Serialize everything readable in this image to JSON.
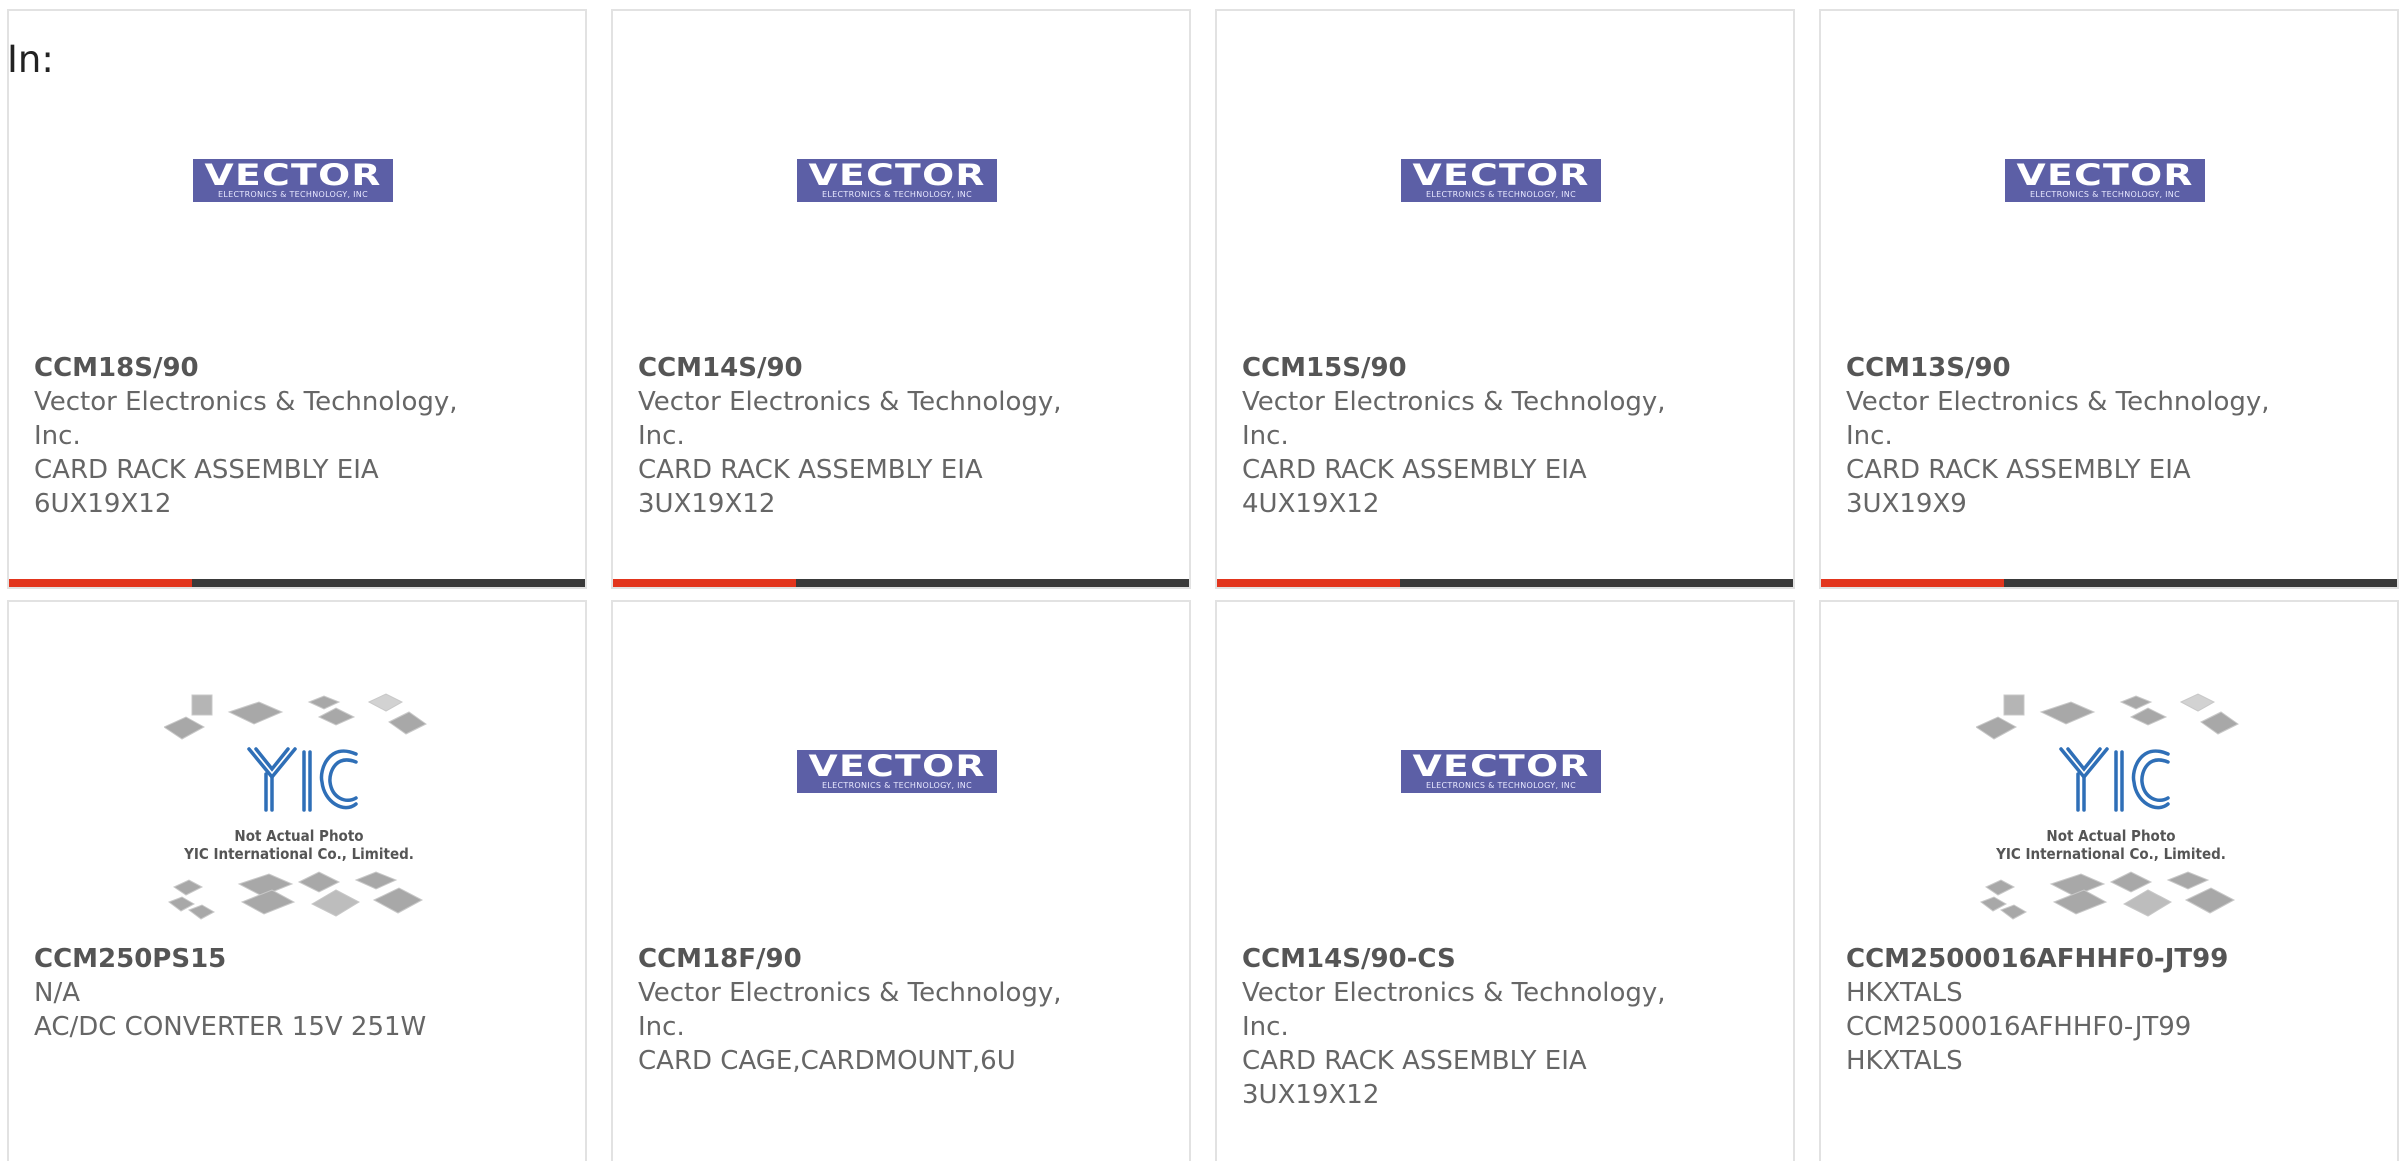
{
  "header": {
    "label": "In:"
  },
  "colors": {
    "accent": "#e2351d",
    "bar": "#3a3a3a",
    "vector_logo": "#5c5fa6"
  },
  "cards": [
    {
      "image": "vector-logo",
      "part": "CCM18S/90",
      "manufacturer": [
        "Vector Electronics & Technology,",
        "Inc."
      ],
      "description": [
        "CARD RACK ASSEMBLY EIA",
        "6UX19X12"
      ],
      "show_bar": true
    },
    {
      "image": "vector-logo",
      "part": "CCM14S/90",
      "manufacturer": [
        "Vector Electronics & Technology,",
        "Inc."
      ],
      "description": [
        "CARD RACK ASSEMBLY EIA",
        "3UX19X12"
      ],
      "show_bar": true
    },
    {
      "image": "vector-logo",
      "part": "CCM15S/90",
      "manufacturer": [
        "Vector Electronics & Technology,",
        "Inc."
      ],
      "description": [
        "CARD RACK ASSEMBLY EIA",
        "4UX19X12"
      ],
      "show_bar": true
    },
    {
      "image": "vector-logo",
      "part": "CCM13S/90",
      "manufacturer": [
        "Vector Electronics & Technology,",
        "Inc."
      ],
      "description": [
        "CARD RACK ASSEMBLY EIA",
        "3UX19X9"
      ],
      "show_bar": true
    },
    {
      "image": "yic-placeholder",
      "part": "CCM250PS15",
      "manufacturer": [
        "N/A"
      ],
      "description": [
        "AC/DC CONVERTER 15V 251W"
      ],
      "show_bar": false
    },
    {
      "image": "vector-logo",
      "part": "CCM18F/90",
      "manufacturer": [
        "Vector Electronics & Technology,",
        "Inc."
      ],
      "description": [
        "CARD CAGE,CARDMOUNT,6U"
      ],
      "show_bar": false
    },
    {
      "image": "vector-logo",
      "part": "CCM14S/90-CS",
      "manufacturer": [
        "Vector Electronics & Technology,",
        "Inc."
      ],
      "description": [
        "CARD RACK ASSEMBLY EIA",
        "3UX19X12"
      ],
      "show_bar": false
    },
    {
      "image": "yic-placeholder",
      "part": "CCM2500016AFHHF0-JT99",
      "manufacturer": [
        "HKXTALS"
      ],
      "description": [
        "CCM2500016AFHHF0-JT99",
        "HKXTALS"
      ],
      "show_bar": false
    }
  ],
  "logos": {
    "vector": {
      "main": "VECTOR",
      "sub": "ELECTRONICS & TECHNOLOGY, INC"
    },
    "yic": {
      "line1": "Not Actual Photo",
      "line2": "YIC International Co., Limited."
    }
  }
}
